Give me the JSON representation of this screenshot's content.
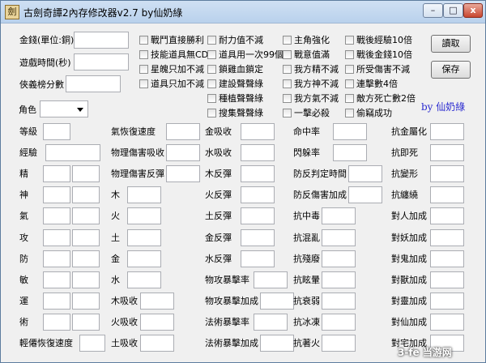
{
  "window": {
    "title": "古劍奇譚2內存修改器v2.7 by仙奶綠",
    "app_icon_glyph": "劍",
    "minimize_glyph": "–",
    "maximize_glyph": "□",
    "close_glyph": "x"
  },
  "top_fields": [
    {
      "label": "金錢(單位:銅)",
      "value": ""
    },
    {
      "label": "遊戲時間(秒)",
      "value": ""
    },
    {
      "label": "俠義榜分數",
      "value": ""
    }
  ],
  "checkboxes": [
    [
      "戰鬥直接勝利",
      "技能道具無CD",
      "星魄只加不減",
      "道具只加不減"
    ],
    [
      "耐力值不減",
      "道具用一次99個",
      "鎖雞血鎖定",
      "建設聲聲綠",
      "種植聲聲綠",
      "搜集聲聲綠"
    ],
    [
      "主角強化",
      "戰意值滿",
      "我方精不減",
      "我方神不減",
      "我方氣不減",
      "一擊必殺"
    ],
    [
      "戰後經驗10倍",
      "戰後金錢10倍",
      "所受傷害不減",
      "連擊數4倍",
      "敵方死亡數2倍",
      "偷竊成功"
    ]
  ],
  "buttons": {
    "read": "讀取",
    "save": "保存"
  },
  "author": "by 仙奶綠",
  "role": {
    "label": "角色",
    "value": ""
  },
  "grid": {
    "col1": [
      "等級",
      "經驗",
      "精",
      "神",
      "氣",
      "攻",
      "防",
      "敏",
      "運",
      "術",
      "輕僊恢復速度"
    ],
    "col2": [
      "氣恢復速度",
      "物理傷害吸收",
      "物理傷害反彈",
      "木",
      "火",
      "土",
      "金",
      "水",
      "木吸收",
      "火吸收",
      "土吸收"
    ],
    "col3": [
      "金吸收",
      "水吸收",
      "木反彈",
      "火反彈",
      "土反彈",
      "金反彈",
      "水反彈",
      "物攻暴擊率",
      "物攻暴擊加成",
      "法術暴擊率",
      "法術暴擊加成"
    ],
    "col4": [
      "命中率",
      "閃躲率",
      "防反判定時間",
      "防反傷害加成",
      "抗中毒",
      "抗混亂",
      "抗殘廢",
      "抗眩暈",
      "抗衰弱",
      "抗冰凍",
      "抗著火"
    ],
    "col5": [
      "抗金屬化",
      "抗即死",
      "抗變形",
      "抗纏繞",
      "對人加成",
      "對妖加成",
      "對鬼加成",
      "對獸加成",
      "對靈加成",
      "對仙加成",
      "對宅加成"
    ]
  },
  "watermark": "3-fe 当游网"
}
